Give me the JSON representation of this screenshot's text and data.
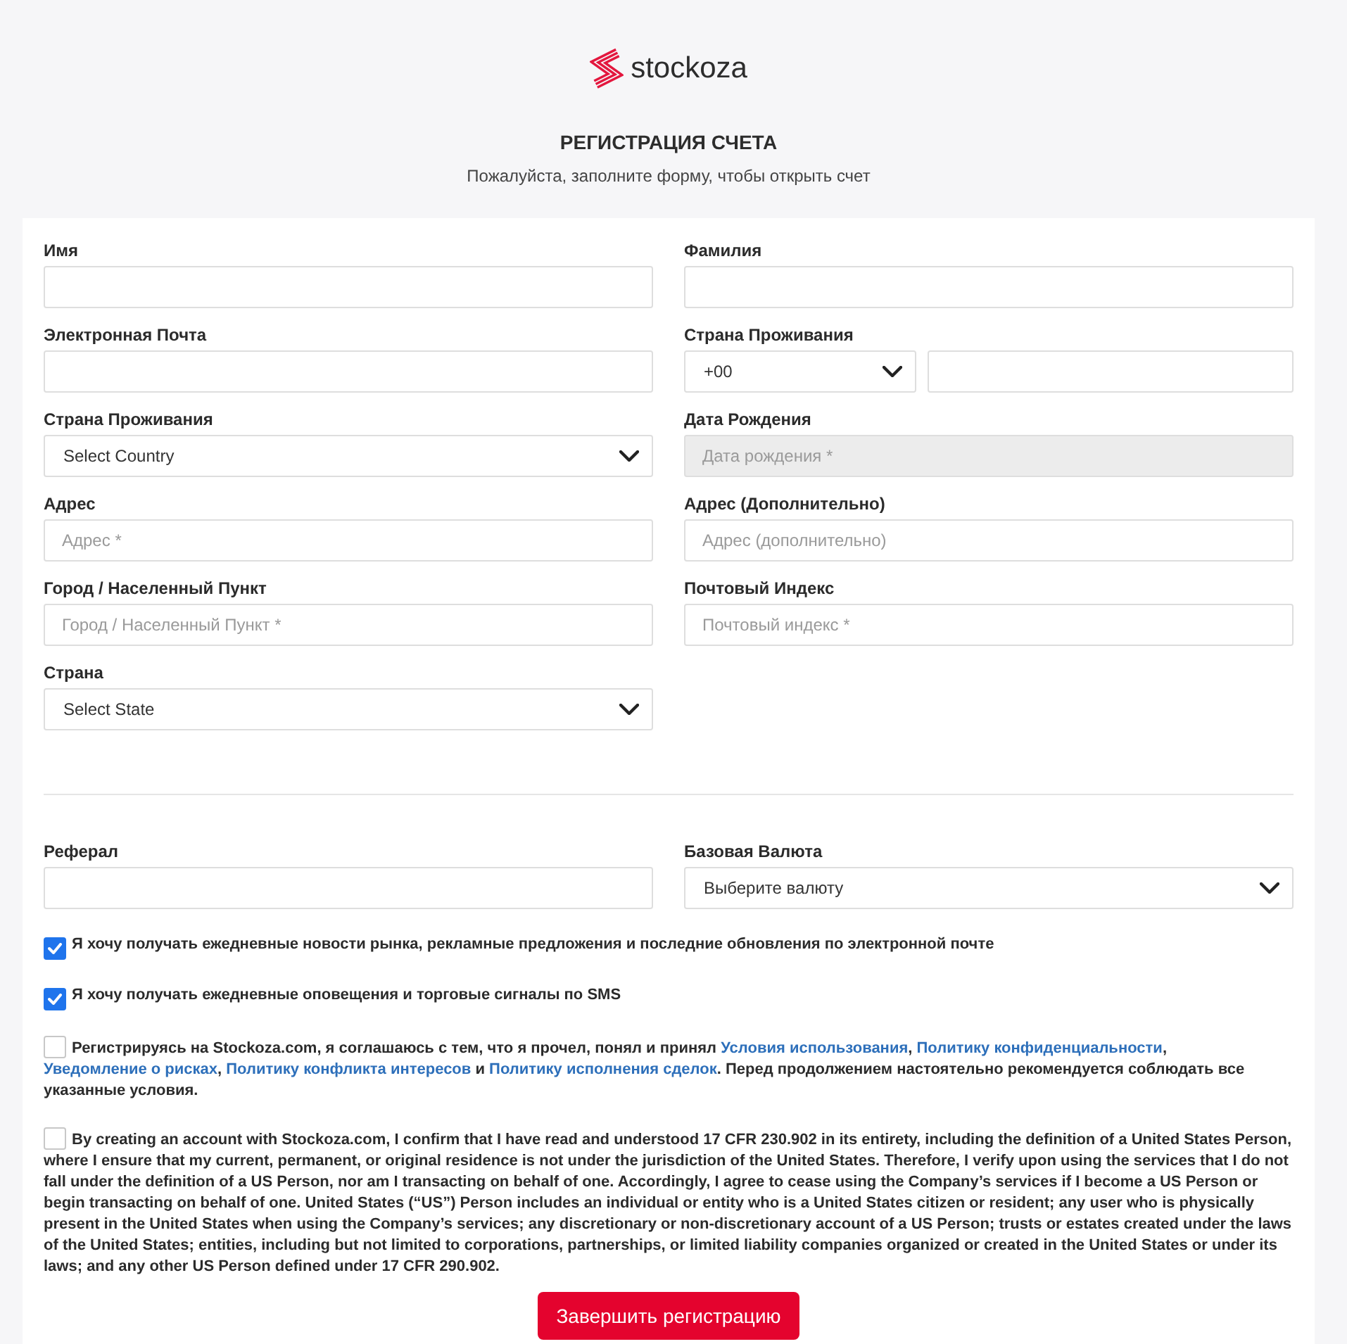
{
  "logo": {
    "text": "stockoza"
  },
  "header": {
    "title": "РЕГИСТРАЦИЯ СЧЕТА",
    "subtitle": "Пожалуйста, заполните форму, чтобы открыть счет"
  },
  "personal_fields": [
    {
      "label": "Имя",
      "kind": "text",
      "disabled": false
    },
    {
      "label": "Фамилия",
      "kind": "text",
      "disabled": false
    },
    {
      "label": "Электронная Почта",
      "kind": "text",
      "disabled": false
    },
    {
      "label": "Страна Проживания",
      "kind": "phone",
      "code": "+00",
      "disabled": false
    },
    {
      "label": "Страна Проживания",
      "kind": "select",
      "value": "Select Country",
      "disabled": false
    },
    {
      "label": "Дата Рождения",
      "kind": "text",
      "placeholder": "Дата рождения *",
      "disabled": true
    },
    {
      "label": "Адрес",
      "kind": "text",
      "placeholder": "Адрес *",
      "disabled": false
    },
    {
      "label": "Адрес (Дополнительно)",
      "kind": "text",
      "placeholder": "Адрес (дополнительно)",
      "disabled": false
    },
    {
      "label": "Город / Населенный Пункт",
      "kind": "text",
      "placeholder": "Город / Населенный Пункт *",
      "disabled": false
    },
    {
      "label": "Почтовый Индекс",
      "kind": "text",
      "placeholder": "Почтовый индекс *",
      "disabled": false
    },
    {
      "label": "Страна",
      "kind": "select",
      "value": "Select State",
      "disabled": false
    }
  ],
  "account_fields": [
    {
      "label": "Реферал",
      "kind": "text",
      "disabled": false
    },
    {
      "label": "Базовая Валюта",
      "kind": "select",
      "value": "Выберите валюту",
      "disabled": false
    }
  ],
  "consents": [
    {
      "checked": true,
      "parts": [
        {
          "kind": "text",
          "text": "Я хочу получать ежедневные новости рынка, рекламные предложения и последние обновления по электронной почте"
        }
      ]
    },
    {
      "checked": true,
      "parts": [
        {
          "kind": "text",
          "text": "Я хочу получать ежедневные оповещения и торговые сигналы по SMS"
        }
      ]
    },
    {
      "checked": false,
      "parts": [
        {
          "kind": "text",
          "text": "Регистрируясь на Stockoza.com, я соглашаюсь с тем, что я прочел, понял и принял "
        },
        {
          "kind": "link",
          "text": "Условия использования"
        },
        {
          "kind": "text",
          "text": ", "
        },
        {
          "kind": "link",
          "text": "Политику конфиденциальности"
        },
        {
          "kind": "text",
          "text": ", "
        },
        {
          "kind": "link",
          "text": "Уведомление о рисках"
        },
        {
          "kind": "text",
          "text": ", "
        },
        {
          "kind": "link",
          "text": "Политику конфликта интересов"
        },
        {
          "kind": "text",
          "text": " и "
        },
        {
          "kind": "link",
          "text": "Политику исполнения сделок"
        },
        {
          "kind": "text",
          "text": ". Перед продолжением настоятельно рекомендуется соблюдать все указанные условия."
        }
      ]
    },
    {
      "checked": false,
      "parts": [
        {
          "kind": "text",
          "text": "By creating an account with Stockoza.com, I confirm that I have read and understood 17 CFR 230.902 in its entirety, including the definition of a United States Person, where I ensure that my current, permanent, or original residence is not under the jurisdiction of the United States. Therefore, I verify upon using the services that I do not fall under the definition of a US Person, nor am I transacting on behalf of one. Accordingly, I agree to cease using the Company’s services if I become a US Person or begin transacting on behalf of one. United States (“US”) Person includes an individual or entity who is a United States citizen or resident; any user who is physically present in the United States when using the Company’s services; any discretionary or non-discretionary account of a US Person; trusts or estates created under the laws of the United States; entities, including but not limited to corporations, partnerships, or limited liability companies organized or created in the United States or under its laws; and any other US Person defined under 17 CFR 290.902."
        }
      ]
    }
  ],
  "submit_button": "Завершить регистрацию"
}
